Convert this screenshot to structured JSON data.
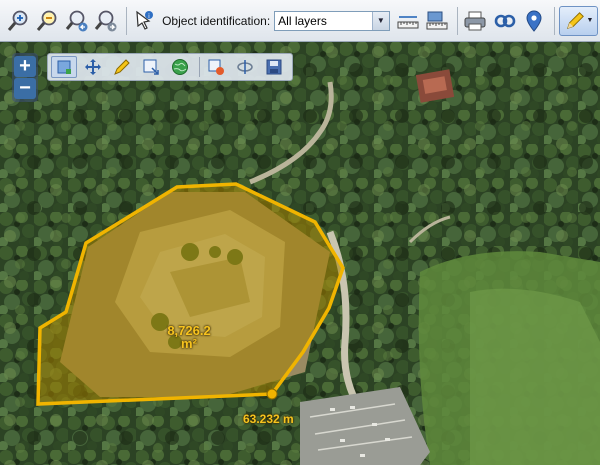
{
  "toolbar": {
    "identification_label": "Object identification:",
    "identification_value": "All layers",
    "tools": [
      "zoom-box-in-icon",
      "zoom-box-out-icon",
      "zoom-previous-icon",
      "zoom-next-icon",
      "identify-icon",
      "measure-length-icon",
      "measure-area-icon",
      "print-icon",
      "link-icon",
      "location-pin-icon",
      "draw-pencil-icon"
    ]
  },
  "zoom": {
    "in_label": "+",
    "out_label": "−"
  },
  "edit_toolbar": {
    "tools": [
      "select-feature-icon",
      "move-icon",
      "edit-vertices-icon",
      "add-feature-icon",
      "globe-icon",
      "delete-feature-icon",
      "split-feature-icon",
      "save-icon"
    ]
  },
  "measurement": {
    "area_value": "8,726.2",
    "area_unit": "m²",
    "length_value": "63.232 m"
  },
  "colors": {
    "polygon_stroke": "#f0b400",
    "polygon_fill": "#b08a00",
    "label": "#f7c31e"
  }
}
